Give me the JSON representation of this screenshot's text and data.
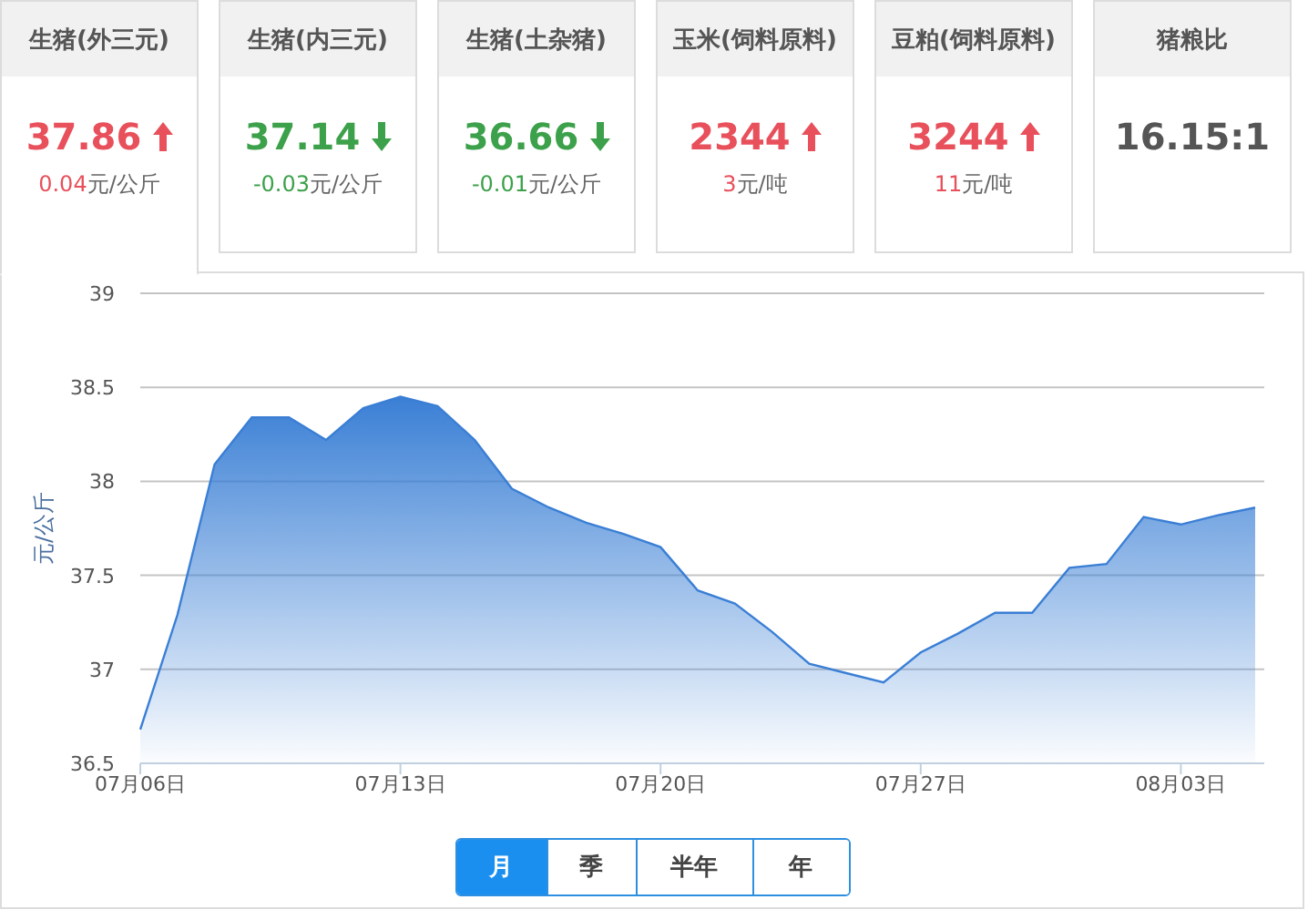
{
  "cards": [
    {
      "title": "生猪(外三元)",
      "value": "37.86",
      "kind": "up",
      "change": "0.04",
      "unit": "元/公斤",
      "selected": true
    },
    {
      "title": "生猪(内三元)",
      "value": "37.14",
      "kind": "down",
      "change": "-0.03",
      "unit": "元/公斤",
      "selected": false
    },
    {
      "title": "生猪(土杂猪)",
      "value": "36.66",
      "kind": "down",
      "change": "-0.01",
      "unit": "元/公斤",
      "selected": false
    },
    {
      "title": "玉米(饲料原料)",
      "value": "2344",
      "kind": "up",
      "change": "3",
      "unit": "元/吨",
      "selected": false
    },
    {
      "title": "豆粕(饲料原料)",
      "value": "3244",
      "kind": "up",
      "change": "11",
      "unit": "元/吨",
      "selected": false
    },
    {
      "title": "猪粮比",
      "value": "16.15:1",
      "kind": "flat",
      "selected": false
    }
  ],
  "chart": {
    "chart_data": {
      "type": "area",
      "ylabel": "元/公斤",
      "grid": true,
      "categories": [
        "07月06日",
        null,
        null,
        null,
        null,
        null,
        null,
        "07月13日",
        null,
        null,
        null,
        null,
        null,
        null,
        "07月20日",
        null,
        null,
        null,
        null,
        null,
        null,
        "07月27日",
        null,
        null,
        null,
        null,
        null,
        null,
        "08月03日",
        null,
        null
      ],
      "series": [
        {
          "color": "#3a7fd5",
          "values": [
            36.68,
            37.29,
            38.09,
            38.34,
            38.34,
            38.22,
            38.39,
            38.45,
            38.4,
            38.22,
            37.96,
            37.86,
            37.78,
            37.72,
            37.65,
            37.42,
            37.35,
            37.2,
            37.03,
            36.98,
            36.93,
            37.09,
            37.19,
            37.3,
            37.3,
            37.54,
            37.56,
            37.81,
            37.77,
            37.82,
            37.86
          ]
        }
      ],
      "ylim": [
        36.5,
        39
      ],
      "yticks": [
        36.5,
        37,
        37.5,
        38,
        38.5,
        39
      ]
    }
  },
  "ranges": [
    {
      "label": "月",
      "selected": true
    },
    {
      "label": "季",
      "selected": false
    },
    {
      "label": "半年",
      "selected": false
    },
    {
      "label": "年",
      "selected": false
    }
  ]
}
